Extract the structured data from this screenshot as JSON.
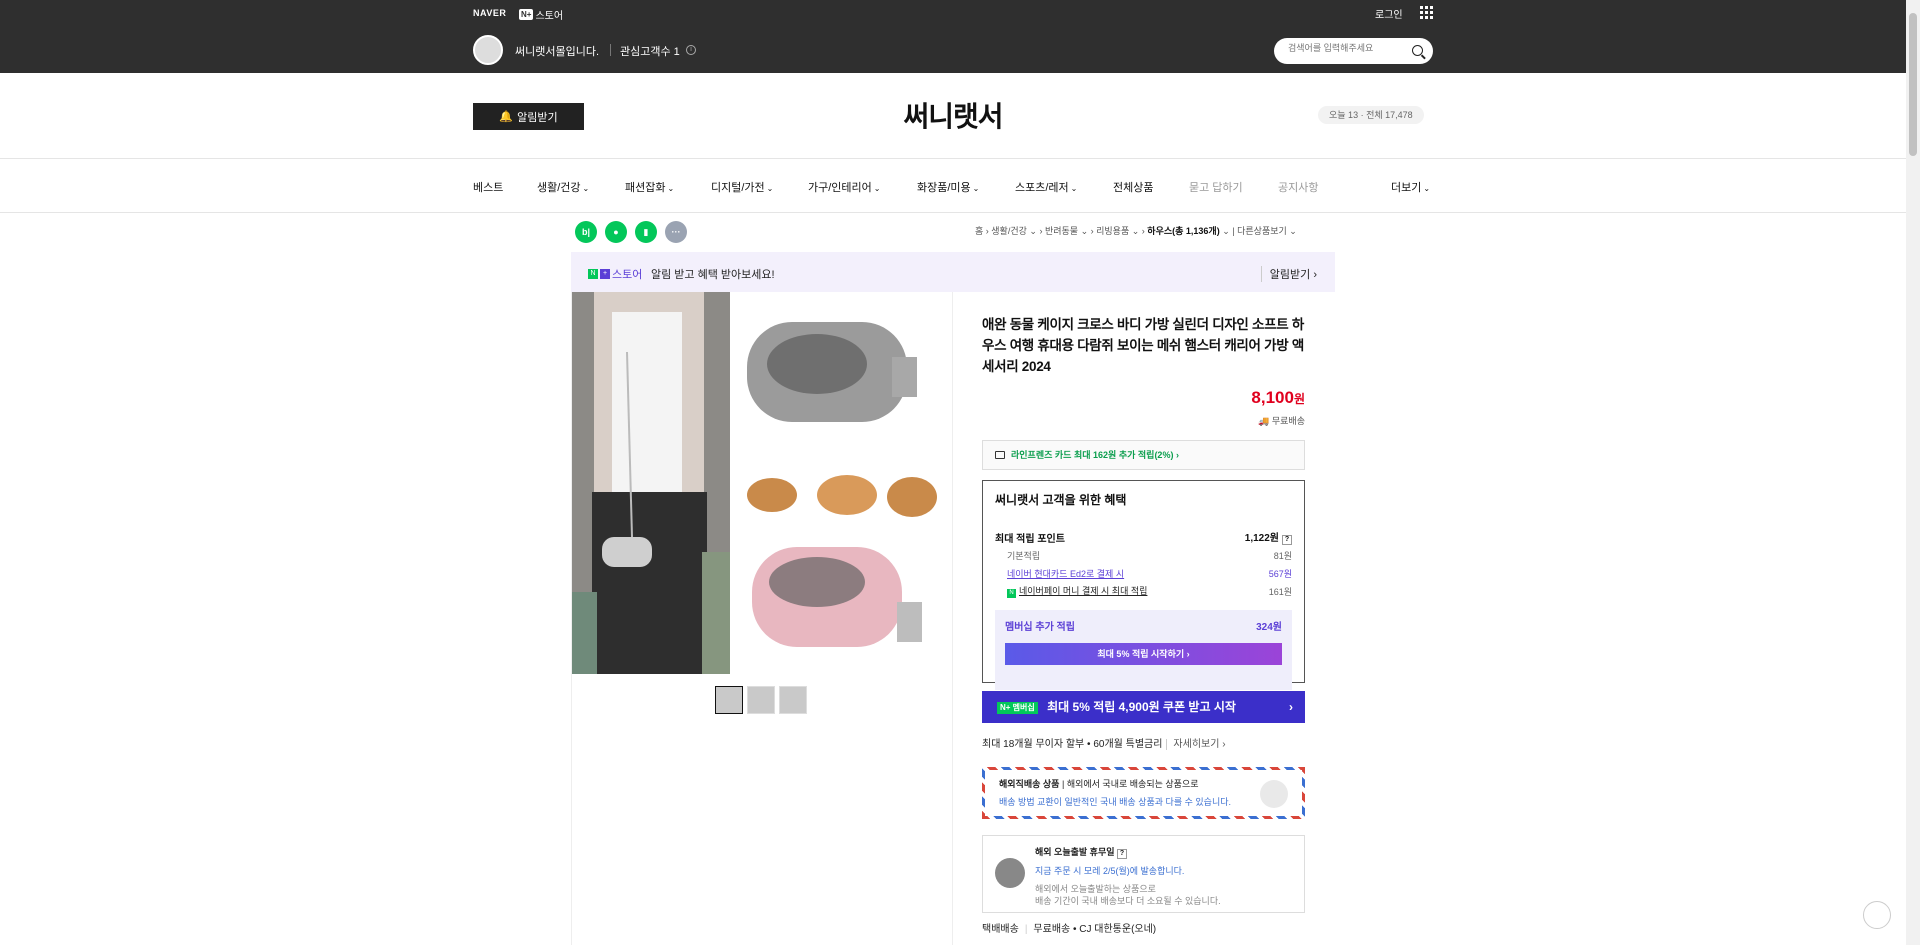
{
  "topbar": {
    "naver": "NAVER",
    "plus_badge": "N+",
    "plus_store": "스토어",
    "login": "로그인",
    "store_name": "써니랫서몰입니다.",
    "followers_label": "관심고객수 1",
    "search_placeholder": "검색어를 입력해주세요"
  },
  "header": {
    "notify_button": "알림받기",
    "store_title": "써니랫서",
    "visits": "오늘 13 · 전체 17,478"
  },
  "nav": {
    "items": [
      "베스트",
      "생활/건강",
      "패션잡화",
      "디지털/가전",
      "가구/인테리어",
      "화장품/미용",
      "스포츠/레저",
      "전체상품",
      "묻고 답하기",
      "공지사항",
      "더보기"
    ]
  },
  "breadcrumb": {
    "home": "홈",
    "c1": "생활/건강",
    "c2": "반려동물",
    "c3": "리빙용품",
    "c4": "하우스(총 1,136개)",
    "other": "다른상품보기"
  },
  "alert_banner": {
    "logo_text": "스토어",
    "text": "알림 받고 혜택 받아보세요!",
    "button": "알림받기"
  },
  "product": {
    "title": "애완 동물 케이지 크로스 바디 가방 실린더 디자인 소프트 하우스 여행 휴대용 다람쥐 보이는 메쉬 햄스터 캐리어 가방 액세서리 2024",
    "price": "8,100",
    "price_unit": "원",
    "shipping": "무료배송",
    "card_benefit": "라인프렌즈 카드 최대 162원 추가 적립(2%)"
  },
  "benefit": {
    "heading": "써니랫서 고객을 위한 혜택",
    "max_point_label": "최대 적립 포인트",
    "max_point_value": "1,122원",
    "basic_label": "기본적립",
    "basic_value": "81원",
    "card_label": "네이버 현대카드 Ed2로 결제 시",
    "card_value": "567원",
    "pay_label": "네이버페이 머니 결제 시 최대 적립",
    "pay_value": "161원",
    "membership_label": "멤버십 추가 적립",
    "membership_value": "324원",
    "membership_button": "최대 5% 적립 시작하기"
  },
  "promo": {
    "badge": "N+ 멤버십",
    "text": "최대 5% 적립 4,900원 쿠폰 받고 시작"
  },
  "installment": {
    "text": "최대 18개월 무이자 할부 • 60개월 특별금리",
    "more": "자세히보기"
  },
  "overseas": {
    "label": "해외직배송 상품",
    "desc": "해외에서 국내로 배송되는 상품으로",
    "note": "배송 방법 교환이 일반적인 국내 배송 상품과 다를 수 있습니다."
  },
  "today": {
    "title": "해외 오늘출발 휴무일",
    "line1": "지금 주문 시 모레 2/5(월)에 발송합니다.",
    "line2": "해외에서 오늘출발하는 상품으로",
    "line3": "배송 기간이 국내 배송보다 더 소요될 수 있습니다."
  },
  "delivery": {
    "label": "택배배송",
    "value": "무료배송 • CJ 대한통운(오네)"
  }
}
